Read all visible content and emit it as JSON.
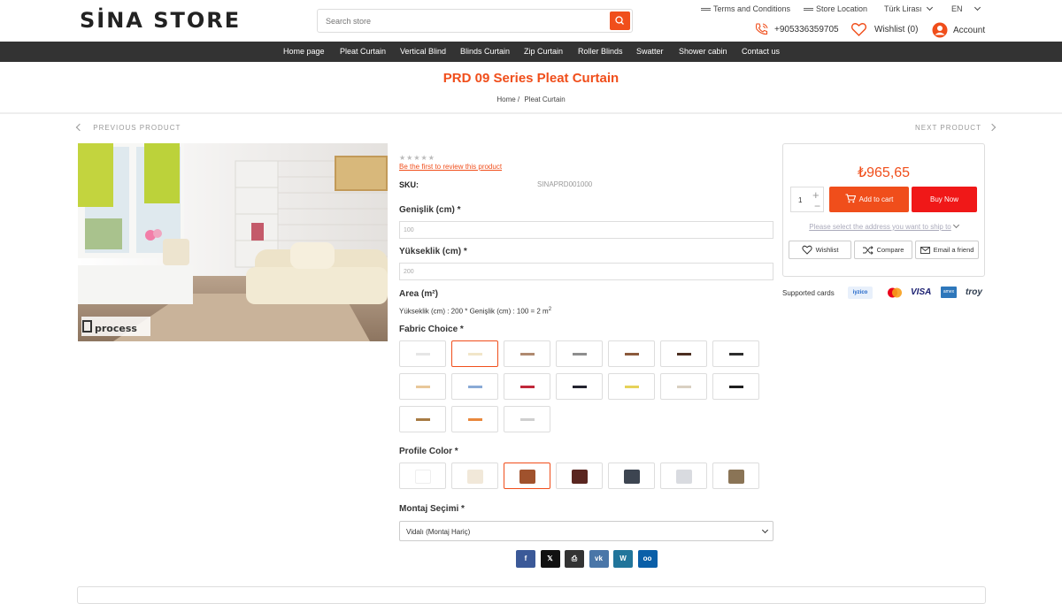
{
  "header": {
    "logo": "SİNA STORE",
    "search_placeholder": "Search store",
    "top_links": [
      "Terms and Conditions",
      "Store Location"
    ],
    "currency": "Türk Lirası",
    "language": "EN",
    "phone": "+905336359705",
    "wishlist": "Wishlist (0)",
    "account": "Account"
  },
  "nav": [
    "Home page",
    "Pleat Curtain",
    "Vertical Blind",
    "Blinds Curtain",
    "Zip Curtain",
    "Roller Blinds",
    "Swatter",
    "Shower cabin",
    "Contact us"
  ],
  "page": {
    "title": "PRD 09 Series Pleat Curtain",
    "breadcrumb_home": "Home",
    "breadcrumb_sep": "/",
    "breadcrumb_current": "Pleat Curtain",
    "prev": "PREVIOUS PRODUCT",
    "next": "NEXT PRODUCT"
  },
  "product": {
    "image_brand": "process",
    "stars": "★★★★★",
    "review_link": "Be the first to review this product",
    "sku_label": "SKU:",
    "sku_value": "SINAPRD001000",
    "width_label": "Genişlik (cm) *",
    "width_value": "100",
    "height_label": "Yükseklik (cm) *",
    "height_value": "200",
    "area_label": "Area (m²)",
    "area_text": "Yükseklik (cm) : 200 * Genişlik (cm) : 100 = 2 m",
    "area_sup": "2",
    "fabric_label": "Fabric Choice *",
    "fabric_colors": [
      "#f2f2f2",
      "#f1e6c9",
      "#b08a70",
      "#8e8e8e",
      "#8b5a3c",
      "#4b2e20",
      "#2d2d2d",
      "#e8c89a",
      "#8aaad6",
      "#c0283a",
      "#23232f",
      "#e6d25a",
      "#d9d0c2",
      "#1e1e1e",
      "#a77b44",
      "#e9883c",
      "#cfcfcf"
    ],
    "fabric_selected": 1,
    "profile_label": "Profile Color *",
    "profile_colors": [
      "#ffffff",
      "#f1e8d9",
      "#a0522d",
      "#5a2620",
      "#3d4551",
      "#d9dbe0",
      "#8a7456"
    ],
    "profile_selected": 2,
    "mount_label": "Montaj Seçimi *",
    "mount_value": "Vidalı (Montaj Hariç)",
    "share": [
      {
        "name": "facebook",
        "label": "f",
        "color": "#3b5998"
      },
      {
        "name": "twitter",
        "label": "𝕏",
        "color": "#111111"
      },
      {
        "name": "print",
        "label": "⎙",
        "color": "#333333"
      },
      {
        "name": "vk",
        "label": "vk",
        "color": "#4a76a8"
      },
      {
        "name": "wordpress",
        "label": "W",
        "color": "#21759b"
      },
      {
        "name": "delicious",
        "label": "oo",
        "color": "#0a5fa8"
      }
    ]
  },
  "buy_box": {
    "price": "₺965,65",
    "qty": "1",
    "add_to_cart": "Add to cart",
    "buy_now": "Buy Now",
    "address_note": "Please select the address you want to ship to",
    "wishlist": "Wishlist",
    "compare": "Compare",
    "email": "Email a friend",
    "supported_cards": "Supported cards",
    "cards": [
      "iyzico",
      "mastercard",
      "VISA",
      "amex",
      "troy"
    ]
  }
}
